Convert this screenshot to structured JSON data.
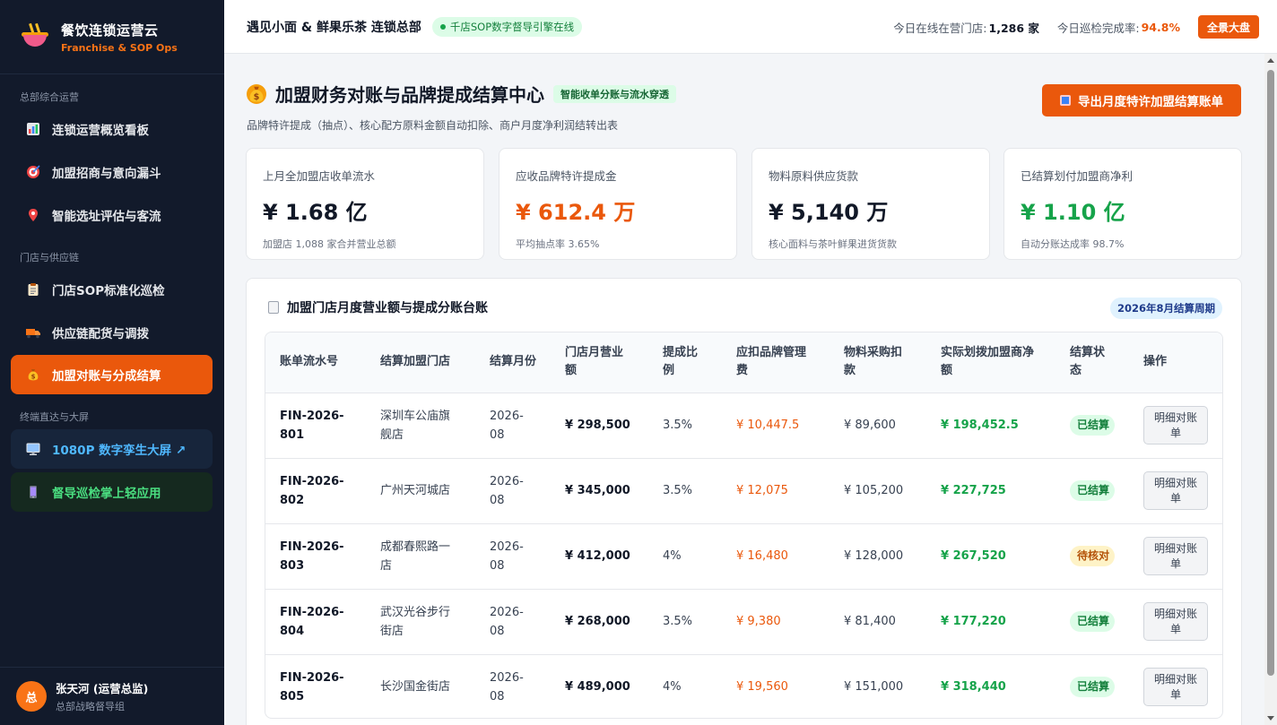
{
  "brand": {
    "name": "餐饮连锁运营云",
    "sub": "Franchise & SOP Ops",
    "icon": "noodle-bowl-icon"
  },
  "sidebar": {
    "sections": [
      "总部综合运营",
      "门店与供应链",
      "终端直达与大屏"
    ],
    "items": [
      {
        "label": "连锁运营概览看板",
        "icon": "bar-chart-icon"
      },
      {
        "label": "加盟招商与意向漏斗",
        "icon": "target-icon"
      },
      {
        "label": "智能选址评估与客流",
        "icon": "map-pin-icon"
      },
      {
        "label": "门店SOP标准化巡检",
        "icon": "clipboard-icon"
      },
      {
        "label": "供应链配货与调拨",
        "icon": "truck-icon"
      },
      {
        "label": "加盟对账与分成结算",
        "icon": "money-bag-icon",
        "active": true
      },
      {
        "label": "1080P 数字孪生大屏 ↗",
        "icon": "monitor-icon"
      },
      {
        "label": "督导巡检掌上轻应用",
        "icon": "phone-icon"
      }
    ]
  },
  "user": {
    "avatar": "总",
    "name": "张天河 (运营总监)",
    "role": "总部战略督导组"
  },
  "header": {
    "org": "遇见小面 & 鲜果乐茶 连锁总部",
    "status": "千店SOP数字督导引擎在线",
    "online_label": "今日在线在营门店:",
    "online_value": "1,286 家",
    "patrol_label": "今日巡检完成率:",
    "patrol_value": "94.8%",
    "bigscreen_btn": "全景大盘"
  },
  "page": {
    "title": "加盟财务对账与品牌提成结算中心",
    "title_icon": "money-bag-icon",
    "badge": "智能收单分账与流水穿透",
    "subtitle": "品牌特许提成（抽点）、核心配方原料金额自动扣除、商户月度净利润结转出表",
    "export_btn": "导出月度特许加盟结算账单"
  },
  "kpis": [
    {
      "label": "上月全加盟店收单流水",
      "value": "¥ 1.68 亿",
      "note": "加盟店 1,088 家合并营业总额",
      "color": "#111827"
    },
    {
      "label": "应收品牌特许提成金",
      "value": "¥ 612.4 万",
      "note": "平均抽点率 3.65%",
      "color": "#ea580c"
    },
    {
      "label": "物料原料供应货款",
      "value": "¥ 5,140 万",
      "note": "核心面料与茶叶鲜果进货货款",
      "color": "#111827"
    },
    {
      "label": "已结算划付加盟商净利",
      "value": "¥ 1.10 亿",
      "note": "自动分账达成率 98.7%",
      "color": "#16a34a"
    }
  ],
  "ledger": {
    "title": "加盟门店月度营业额与提成分账台账",
    "period": "2026年8月结算周期",
    "columns": [
      "账单流水号",
      "结算加盟门店",
      "结算月份",
      "门店月营业额",
      "提成比例",
      "应扣品牌管理费",
      "物料采购扣款",
      "实际划拨加盟商净额",
      "结算状态",
      "操作"
    ],
    "rows": [
      {
        "id": "FIN-2026-801",
        "store": "深圳车公庙旗舰店",
        "month": "2026-08",
        "revenue": "¥ 298,500",
        "rate": "3.5%",
        "fee": "¥ 10,447.5",
        "material": "¥ 89,600",
        "net": "¥ 198,452.5",
        "status": "已结算",
        "status_type": "done",
        "action": "明细对账单"
      },
      {
        "id": "FIN-2026-802",
        "store": "广州天河城店",
        "month": "2026-08",
        "revenue": "¥ 345,000",
        "rate": "3.5%",
        "fee": "¥ 12,075",
        "material": "¥ 105,200",
        "net": "¥ 227,725",
        "status": "已结算",
        "status_type": "done",
        "action": "明细对账单"
      },
      {
        "id": "FIN-2026-803",
        "store": "成都春熙路一店",
        "month": "2026-08",
        "revenue": "¥ 412,000",
        "rate": "4%",
        "fee": "¥ 16,480",
        "material": "¥ 128,000",
        "net": "¥ 267,520",
        "status": "待核对",
        "status_type": "pending",
        "action": "明细对账单"
      },
      {
        "id": "FIN-2026-804",
        "store": "武汉光谷步行街店",
        "month": "2026-08",
        "revenue": "¥ 268,000",
        "rate": "3.5%",
        "fee": "¥ 9,380",
        "material": "¥ 81,400",
        "net": "¥ 177,220",
        "status": "已结算",
        "status_type": "done",
        "action": "明细对账单"
      },
      {
        "id": "FIN-2026-805",
        "store": "长沙国金街店",
        "month": "2026-08",
        "revenue": "¥ 489,000",
        "rate": "4%",
        "fee": "¥ 19,560",
        "material": "¥ 151,000",
        "net": "¥ 318,440",
        "status": "已结算",
        "status_type": "done",
        "action": "明细对账单"
      }
    ]
  },
  "colors": {
    "accent": "#ea580c",
    "success": "#16a34a",
    "sidebar_bg": "#121a2b"
  }
}
